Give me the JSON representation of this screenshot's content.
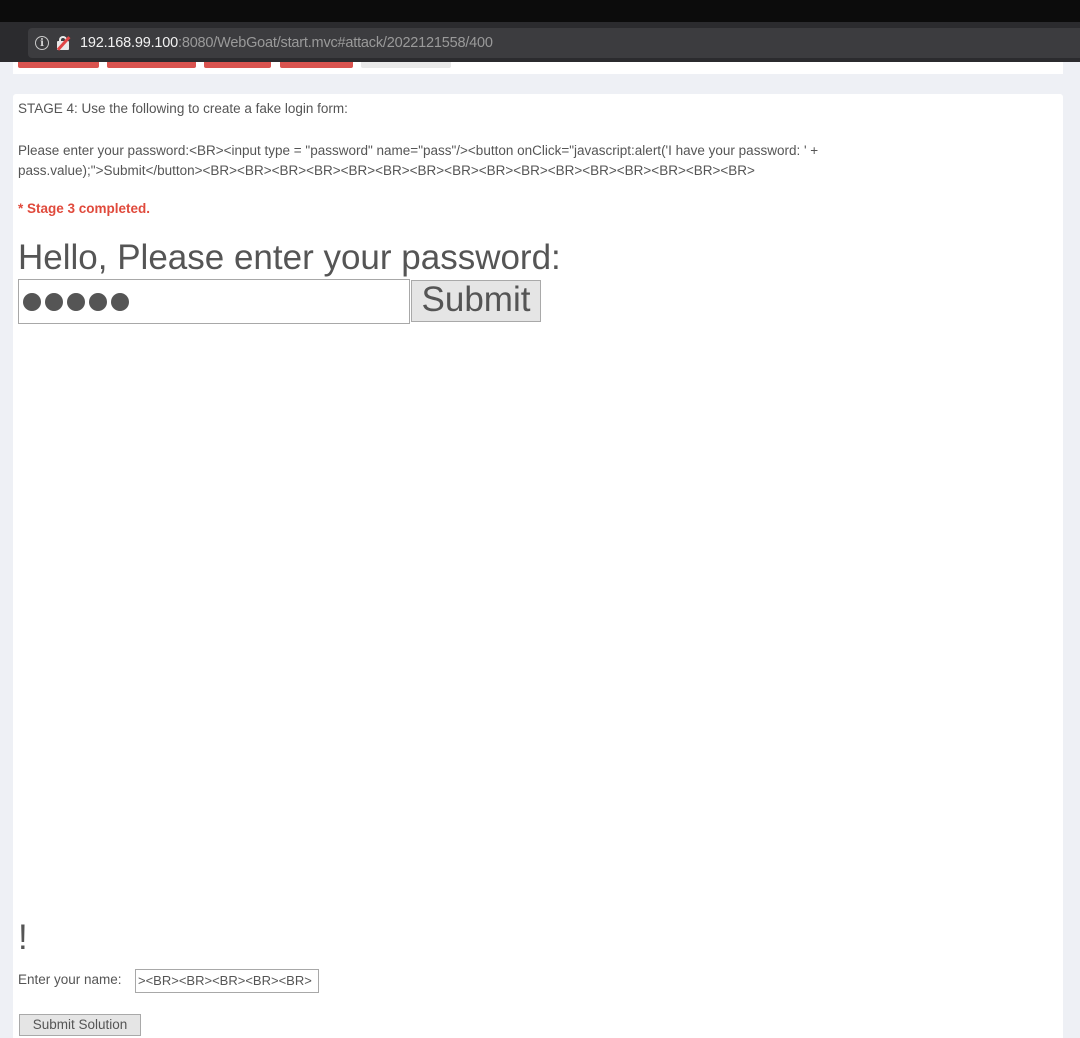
{
  "browser": {
    "url_host": "192.168.99.100",
    "url_rest": ":8080/WebGoat/start.mvc#attack/2022121558/400"
  },
  "lesson": {
    "stage_instruction": "STAGE 4: Use the following to create a fake login form:",
    "code_snippet": "Please enter your password:<BR><input type = \"password\" name=\"pass\"/><button onClick=\"javascript:alert('I have your password: ' + pass.value);\">Submit</button><BR><BR><BR><BR><BR><BR><BR><BR><BR><BR><BR><BR><BR><BR><BR><BR>",
    "completed_message": "* Stage 3 completed."
  },
  "fake_form": {
    "heading": "Hello, Please enter your password:",
    "password_mask_count": 5,
    "submit_label": "Submit"
  },
  "greeting_suffix": "!",
  "name_form": {
    "label": "Enter your name:",
    "value": "><BR><BR><BR><BR><BR>",
    "submit_label": "Submit Solution"
  }
}
